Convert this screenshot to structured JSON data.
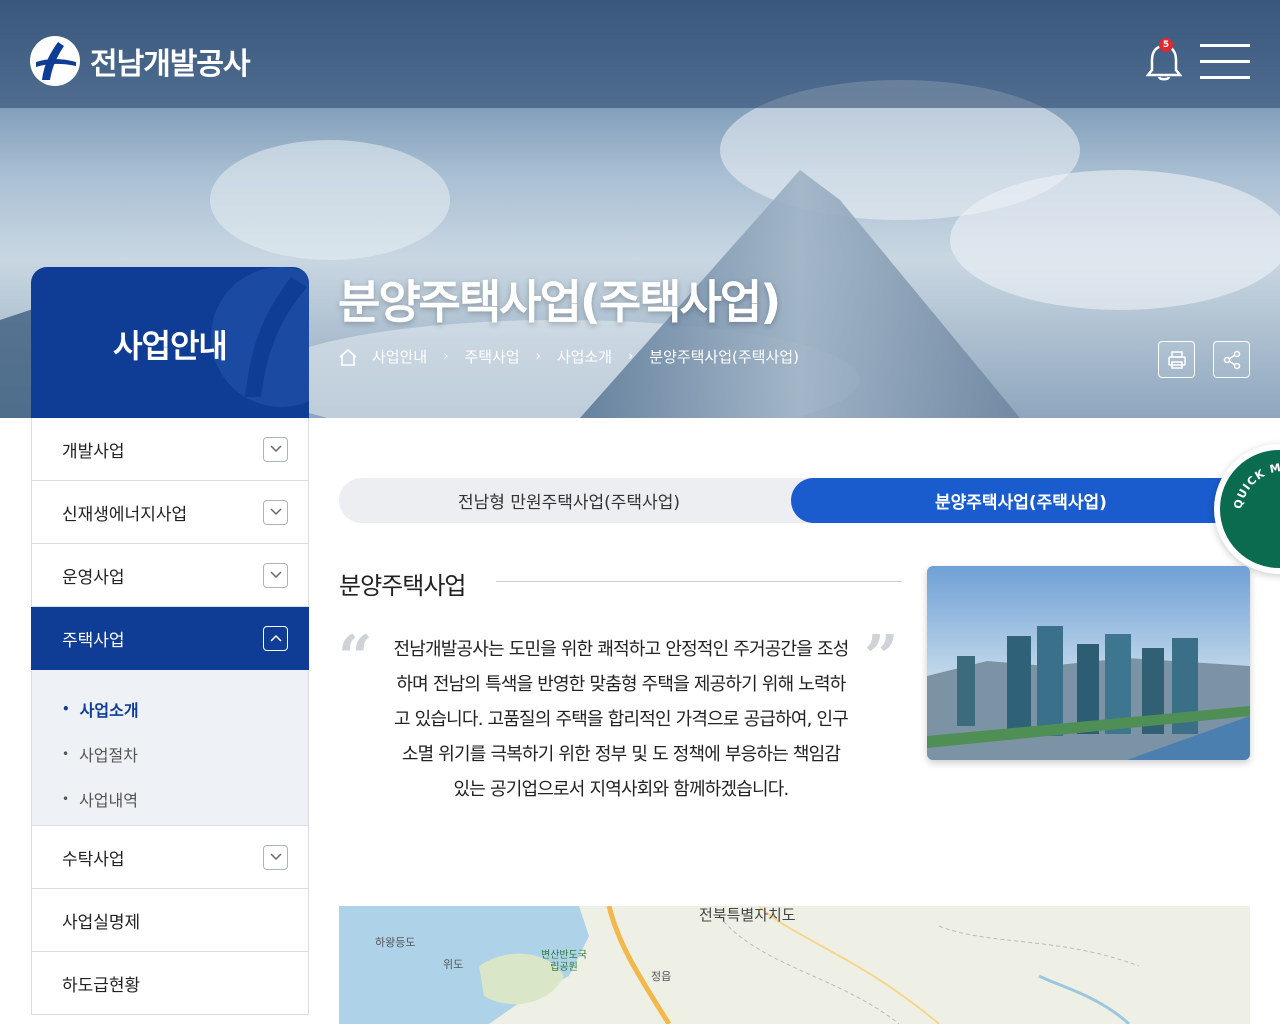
{
  "header": {
    "logo_text": "전남개발공사",
    "notification_count": "5"
  },
  "hero": {
    "section_title": "사업안내",
    "page_title": "분양주택사업(주택사업)",
    "breadcrumb": [
      "사업안내",
      "주택사업",
      "사업소개",
      "분양주택사업(주택사업)"
    ]
  },
  "sidebar": {
    "items": [
      {
        "label": "개발사업"
      },
      {
        "label": "신재생에너지사업"
      },
      {
        "label": "운영사업"
      },
      {
        "label": "주택사업"
      },
      {
        "label": "수탁사업"
      },
      {
        "label": "사업실명제"
      },
      {
        "label": "하도급현황"
      }
    ],
    "subitems": [
      {
        "label": "사업소개"
      },
      {
        "label": "사업절차"
      },
      {
        "label": "사업내역"
      }
    ]
  },
  "tabs": [
    {
      "label": "전남형 만원주택사업(주택사업)"
    },
    {
      "label": "분양주택사업(주택사업)"
    }
  ],
  "quick_menu": {
    "label": "QUICK MENU SERVICE"
  },
  "content": {
    "section_title": "분양주택사업",
    "intro": "전남개발공사는 도민을 위한 쾌적하고 안정적인 주거공간을 조성하며 전남의 특색을 반영한 맞춤형 주택을 제공하기 위해 노력하고 있습니다. 고품질의 주택을 합리적인 가격으로 공급하여, 인구소멸 위기를 극복하기 위한 정부 및 도 정책에 부응하는 책임감 있는 공기업으로서 지역사회와 함께하겠습니다."
  },
  "map": {
    "labels": [
      "전북특별자치도",
      "하왕등도",
      "위도",
      "변산반도국립공원",
      "정읍"
    ]
  },
  "colors": {
    "primary": "#0f3d96",
    "tab_active": "#1a5ccd",
    "quick_menu": "#0b6b4e"
  }
}
